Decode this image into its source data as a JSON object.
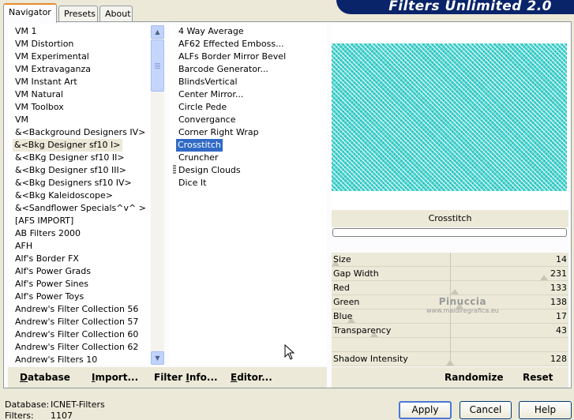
{
  "app": {
    "banner_title": "Filters Unlimited 2.0"
  },
  "tabs": [
    {
      "label": "Navigator",
      "active": true
    },
    {
      "label": "Presets",
      "active": false
    },
    {
      "label": "About",
      "active": false
    }
  ],
  "categories": {
    "items": [
      "VM 1",
      "VM Distortion",
      "VM Experimental",
      "VM Extravaganza",
      "VM Instant Art",
      "VM Natural",
      "VM Toolbox",
      "VM",
      "&<Background Designers IV>",
      "&<Bkg Designer sf10 I>",
      "&<BKg Designer sf10 II>",
      "&<Bkg Designer sf10 III>",
      "&<Bkg Designers sf10 IV>",
      "&<Bkg Kaleidoscope>",
      "&<Sandflower Specials^v^ >",
      "[AFS IMPORT]",
      "AB Filters 2000",
      "AFH",
      "Alf's Border FX",
      "Alf's Power Grads",
      "Alf's Power Sines",
      "Alf's Power Toys",
      "Andrew's Filter Collection 56",
      "Andrew's Filter Collection 57",
      "Andrew's Filter Collection 60",
      "Andrew's Filter Collection 62",
      "Andrew's Filters 10"
    ],
    "selected_index": 9
  },
  "filters": {
    "items": [
      "4 Way Average",
      "AF62 Effected Emboss...",
      "ALFs Border Mirror Bevel",
      "Barcode Generator...",
      "BlindsVertical",
      "Center Mirror...",
      "Circle Pede",
      "Convergance",
      "Corner Right Wrap",
      "Crosstitch",
      "Cruncher",
      "Design Clouds",
      "Dice It"
    ],
    "selected_index": 9
  },
  "preview": {
    "filter_name": "Crosstitch"
  },
  "params": [
    {
      "label": "Size",
      "value": "14",
      "thumb_pct": 0
    },
    {
      "label": "Gap Width",
      "value": "231",
      "thumb_pct": 91
    },
    {
      "label": "Red",
      "value": "133",
      "thumb_pct": 52
    },
    {
      "label": "Green",
      "value": "138",
      "thumb_pct": 54
    },
    {
      "label": "Blue",
      "value": "17",
      "thumb_pct": 7
    },
    {
      "label": "Transparency",
      "value": "43",
      "thumb_pct": 17
    },
    {
      "label": "",
      "value": "",
      "thumb_pct": null
    },
    {
      "label": "Shadow Intensity",
      "value": "128",
      "thumb_pct": 50
    }
  ],
  "watermark": {
    "line1": "Pinuccia",
    "line2": "www.maidiregrafica.eu"
  },
  "bottom_buttons": {
    "database": {
      "pre": "",
      "ul": "D",
      "post": "atabase"
    },
    "import": {
      "pre": "",
      "ul": "I",
      "post": "mport..."
    },
    "filter_info": {
      "pre": "Filter ",
      "ul": "I",
      "post": "nfo..."
    },
    "editor": {
      "pre": "",
      "ul": "E",
      "post": "ditor..."
    },
    "randomize": "Randomize",
    "reset": "Reset"
  },
  "status": {
    "database_label": "Database:",
    "database_value": "ICNET-Filters",
    "filters_label": "Filters:",
    "filters_value": "1107"
  },
  "dialog_buttons": {
    "apply": "Apply",
    "cancel": "Cancel",
    "help": "Help"
  }
}
